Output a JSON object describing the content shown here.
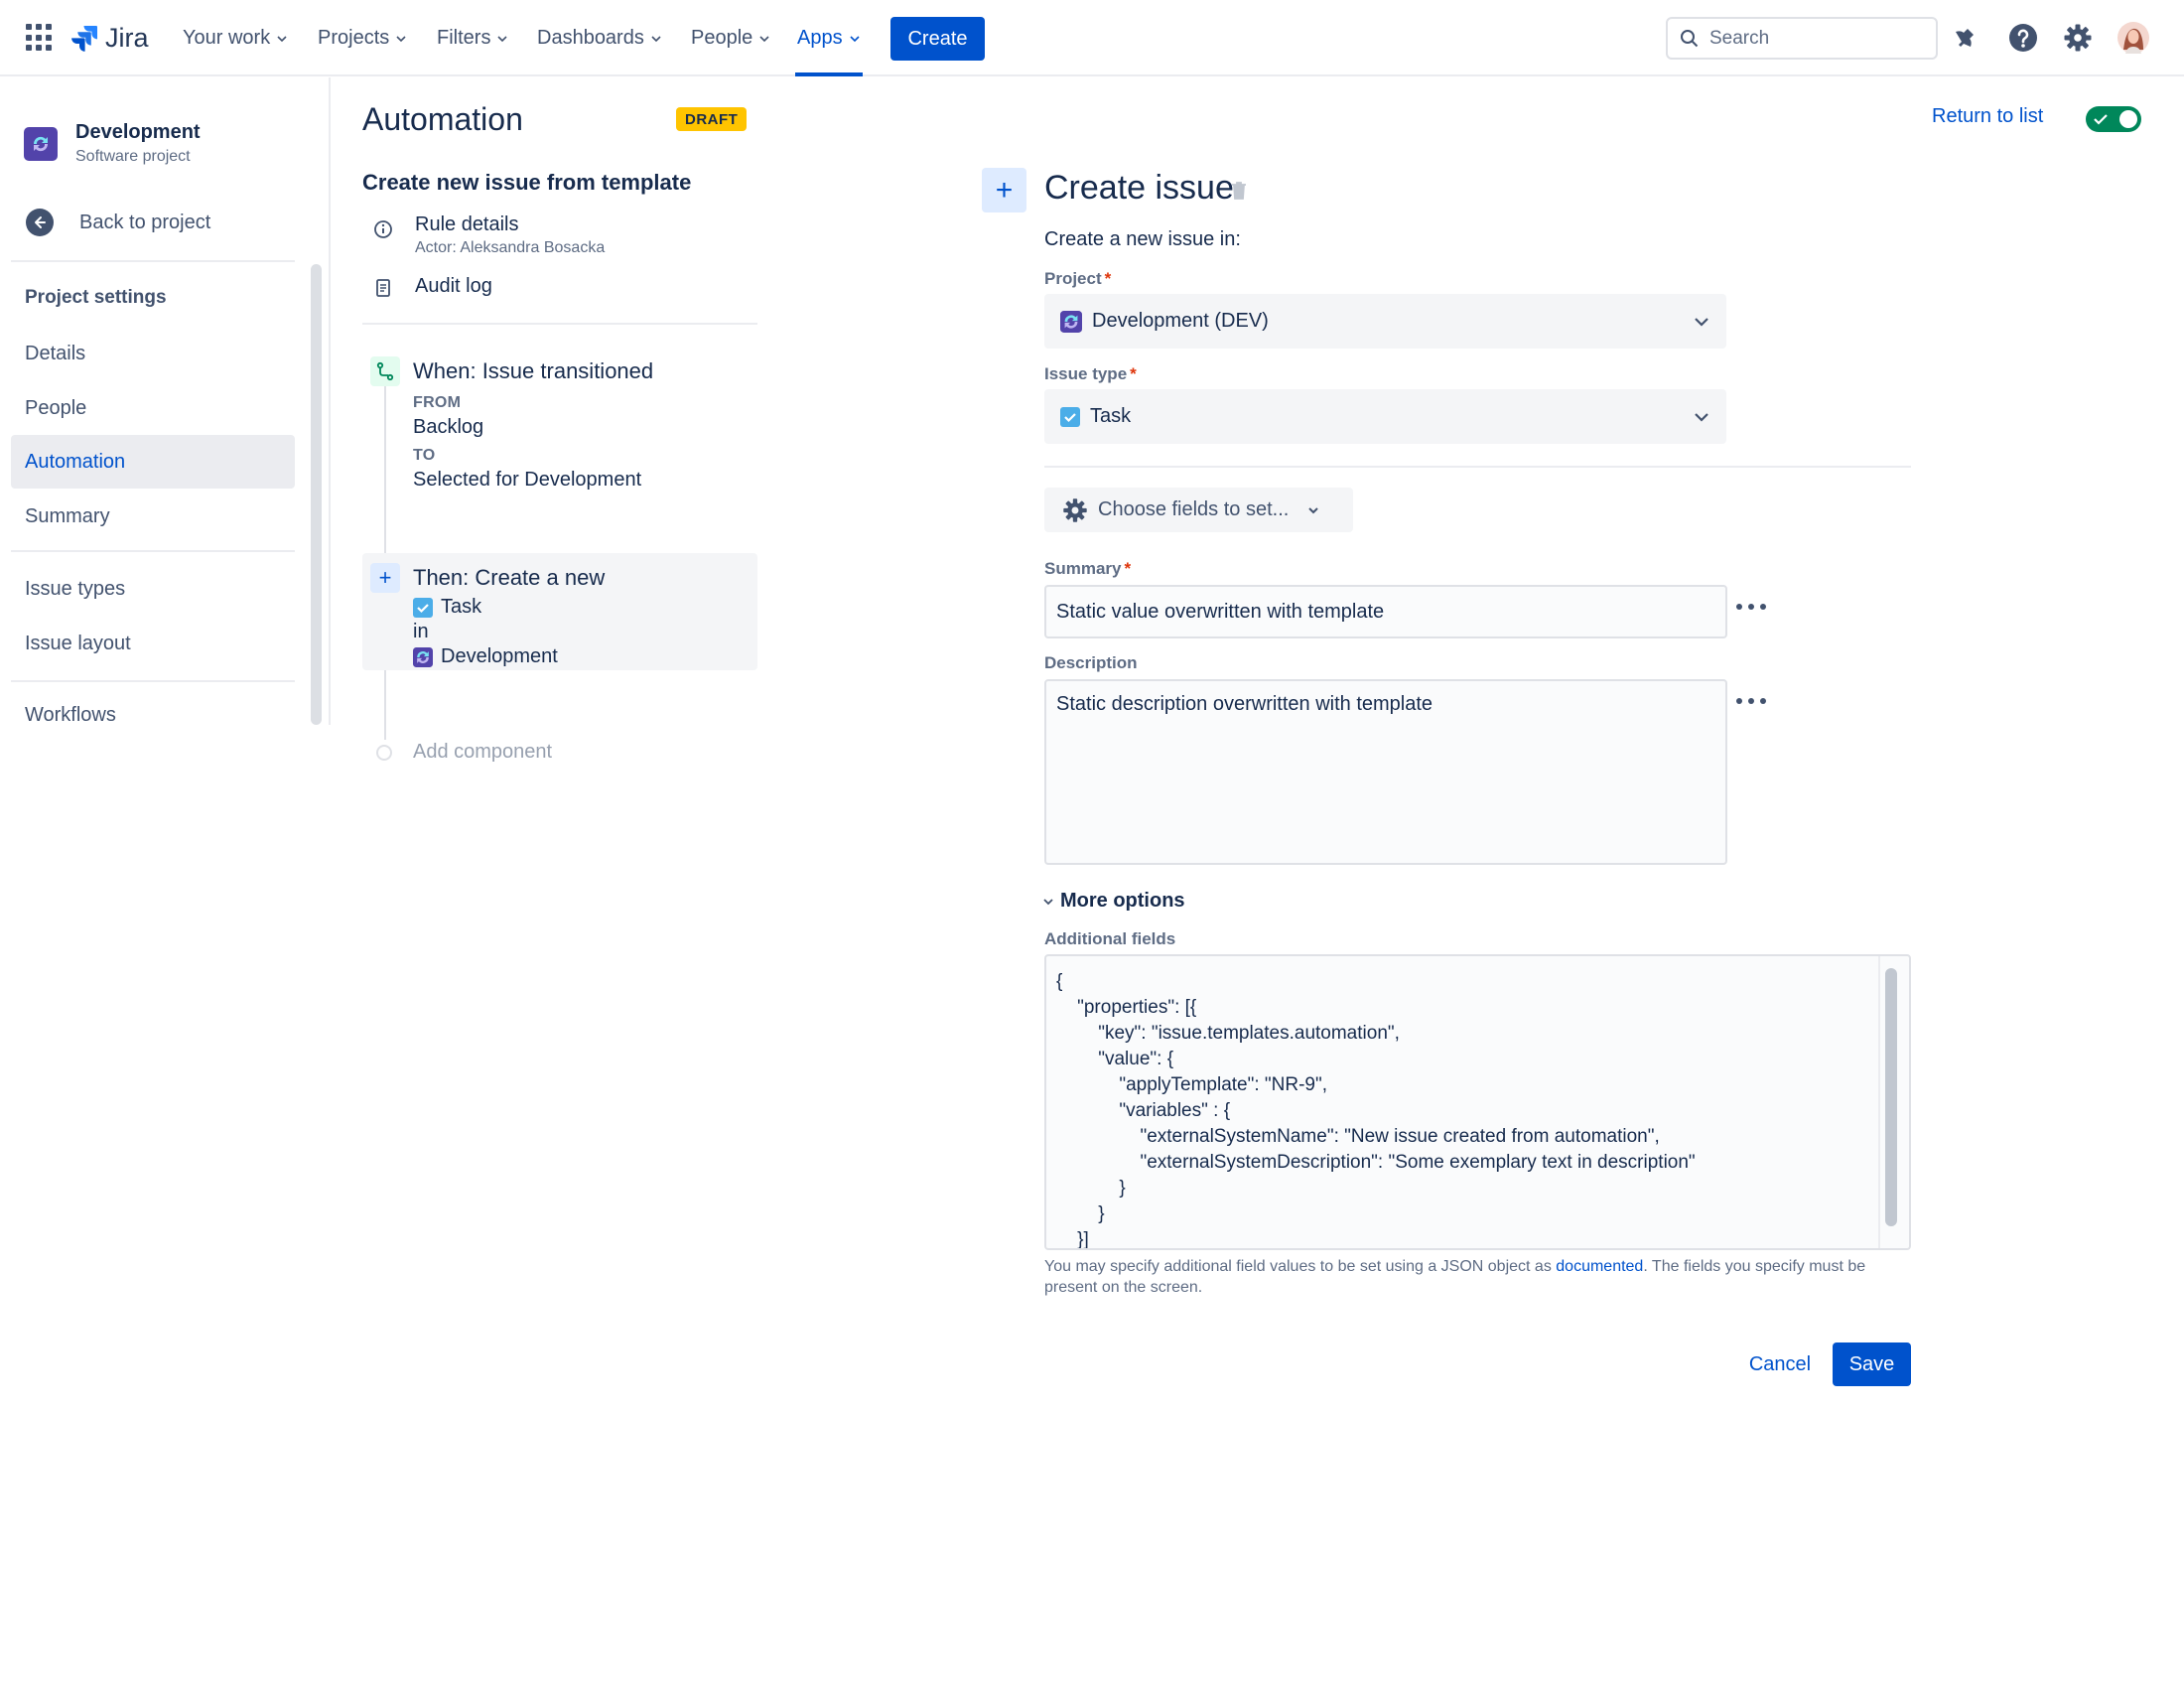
{
  "topnav": {
    "logo_text": "Jira",
    "items": [
      {
        "label": "Your work"
      },
      {
        "label": "Projects"
      },
      {
        "label": "Filters"
      },
      {
        "label": "Dashboards"
      },
      {
        "label": "People"
      },
      {
        "label": "Apps"
      }
    ],
    "active_item": "Apps",
    "create_label": "Create",
    "search_placeholder": "Search",
    "icons": [
      "app-switcher-icon",
      "jira-logo-icon",
      "notification-icon",
      "help-icon",
      "settings-icon",
      "avatar"
    ]
  },
  "sidebar": {
    "project_name": "Development",
    "project_type": "Software project",
    "back_label": "Back to project",
    "heading": "Project settings",
    "items": [
      {
        "label": "Details"
      },
      {
        "label": "People"
      },
      {
        "label": "Automation"
      },
      {
        "label": "Summary"
      },
      {
        "label": "Issue types"
      },
      {
        "label": "Issue layout"
      },
      {
        "label": "Workflows"
      }
    ],
    "selected_item": "Automation"
  },
  "rule": {
    "title": "Automation",
    "status_badge": "DRAFT",
    "name": "Create new issue from template",
    "details_label": "Rule details",
    "actor": "Actor: Aleksandra Bosacka",
    "audit_label": "Audit log",
    "trigger": {
      "title": "When: Issue transitioned",
      "from_caption": "FROM",
      "from_value": "Backlog",
      "to_caption": "TO",
      "to_value": "Selected for Development"
    },
    "action": {
      "title": "Then: Create a new",
      "issue_type": "Task",
      "connector": "in",
      "project": "Development"
    },
    "add_component_label": "Add component"
  },
  "header_right": {
    "return_label": "Return to list",
    "rule_enabled": true
  },
  "form": {
    "title": "Create issue",
    "subtitle": "Create a new issue in:",
    "project_label": "Project",
    "project_value": "Development (DEV)",
    "issue_type_label": "Issue type",
    "issue_type_value": "Task",
    "choose_fields_label": "Choose fields to set...",
    "summary_label": "Summary",
    "summary_value": "Static value overwritten with template",
    "description_label": "Description",
    "description_value": "Static description overwritten with template",
    "more_options_label": "More options",
    "additional_fields_label": "Additional fields",
    "additional_fields_value": "{\n    \"properties\": [{\n        \"key\": \"issue.templates.automation\",\n        \"value\": {\n            \"applyTemplate\": \"NR-9\",\n            \"variables\" : {\n                \"externalSystemName\": \"New issue created from automation\",\n                \"externalSystemDescription\": \"Some exemplary text in description\"\n            }\n        }\n    }]\n}",
    "help_prefix": "You may specify additional field values to be set using a JSON object as ",
    "help_link": "documented",
    "help_suffix": ". The fields you specify must be present on the screen.",
    "required_marker": "*",
    "cancel_label": "Cancel",
    "save_label": "Save"
  },
  "colors": {
    "brand": "#0052cc",
    "draft_badge": "#ffc400",
    "toggle_on": "#00875a",
    "required": "#de350b"
  }
}
